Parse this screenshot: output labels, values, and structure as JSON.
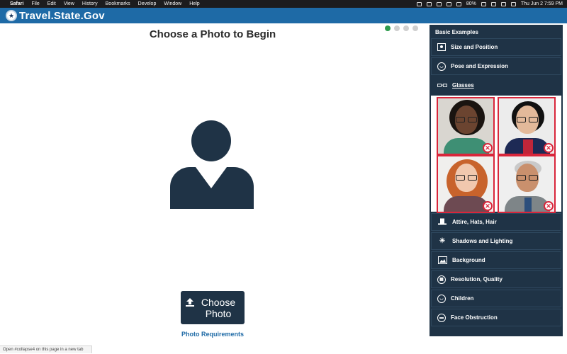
{
  "menubar": {
    "apple": "",
    "items": [
      "Safari",
      "File",
      "Edit",
      "View",
      "History",
      "Bookmarks",
      "Develop",
      "Window",
      "Help"
    ],
    "battery": "80%",
    "clock": "Thu Jun 2  7:59 PM"
  },
  "header": {
    "logo_text": "Travel.State.Gov"
  },
  "main": {
    "title": "Choose a Photo to Begin",
    "progress": {
      "total": 4,
      "current": 1
    },
    "choose_button_label": "Choose Photo",
    "requirements_link": "Photo Requirements"
  },
  "statusbar": {
    "text": "Open #collapse4 on this page in a new tab"
  },
  "sidebar": {
    "heading": "Basic Examples",
    "items": [
      {
        "label": "Size and Position",
        "icon": "portrait-box-icon"
      },
      {
        "label": "Pose and Expression",
        "icon": "smiley-face-icon"
      },
      {
        "label": "Glasses",
        "icon": "glasses-icon"
      },
      {
        "label": "Attire, Hats, Hair",
        "icon": "hat-icon"
      },
      {
        "label": "Shadows and Lighting",
        "icon": "sun-icon"
      },
      {
        "label": "Background",
        "icon": "image-icon"
      },
      {
        "label": "Resolution, Quality",
        "icon": "pixelated-face-icon"
      },
      {
        "label": "Children",
        "icon": "baby-face-icon"
      },
      {
        "label": "Face Obstruction",
        "icon": "obstructed-face-icon"
      }
    ],
    "glasses_examples": [
      {
        "status": "rejected",
        "icon": "x-circle-icon"
      },
      {
        "status": "rejected",
        "icon": "x-circle-icon"
      },
      {
        "status": "rejected",
        "icon": "x-circle-icon"
      },
      {
        "status": "rejected",
        "icon": "x-circle-icon"
      }
    ]
  },
  "colors": {
    "header_blue": "#1e6aa6",
    "navy": "#1f3346",
    "reject_red": "#d9263b",
    "progress_active": "#2e9b4e"
  }
}
